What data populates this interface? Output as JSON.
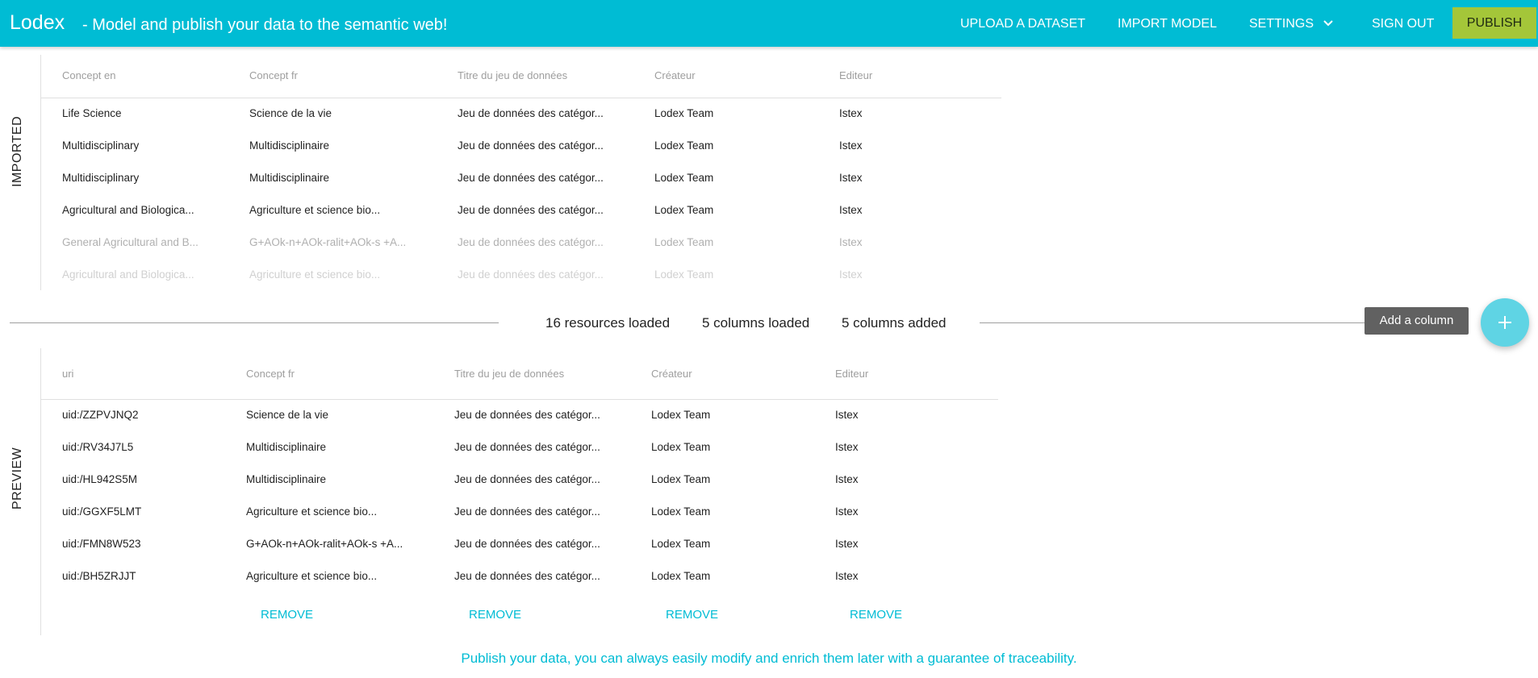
{
  "app": {
    "brand": "Lodex",
    "tagline": "- Model and publish your data to the semantic web!"
  },
  "nav": {
    "upload": "UPLOAD A DATASET",
    "import_model": "IMPORT MODEL",
    "settings": "SETTINGS",
    "sign_out": "SIGN OUT",
    "publish": "PUBLISH",
    "settings_icon": "chevron-down-icon"
  },
  "imported": {
    "label": "IMPORTED",
    "headers": [
      "Concept en",
      "Concept fr",
      "Titre du jeu de données",
      "Créateur",
      "Editeur"
    ],
    "rows": [
      [
        "Life Science",
        "Science de la vie",
        "Jeu de données des catégor...",
        "Lodex Team",
        "Istex"
      ],
      [
        "Multidisciplinary",
        "Multidisciplinaire",
        "Jeu de données des catégor...",
        "Lodex Team",
        "Istex"
      ],
      [
        "Multidisciplinary",
        "Multidisciplinaire",
        "Jeu de données des catégor...",
        "Lodex Team",
        "Istex"
      ],
      [
        "Agricultural and Biologica...",
        "Agriculture et science bio...",
        "Jeu de données des catégor...",
        "Lodex Team",
        "Istex"
      ],
      [
        "General Agricultural and B...",
        "G+AOk-n+AOk-ralit+AOk-s +A...",
        "Jeu de données des catégor...",
        "Lodex Team",
        "Istex"
      ],
      [
        "Agricultural and Biologica...",
        "Agriculture et science bio...",
        "Jeu de données des catégor...",
        "Lodex Team",
        "Istex"
      ]
    ]
  },
  "status": {
    "resources": "16 resources loaded",
    "columns_loaded": "5 columns loaded",
    "columns_added": "5 columns added",
    "add_column_tooltip": "Add a column",
    "fab_icon": "plus-icon"
  },
  "preview": {
    "label": "PREVIEW",
    "headers": [
      "uri",
      "Concept fr",
      "Titre du jeu de données",
      "Créateur",
      "Editeur"
    ],
    "rows": [
      [
        "uid:/ZZPVJNQ2",
        "Science de la vie",
        "Jeu de données des catégor...",
        "Lodex Team",
        "Istex"
      ],
      [
        "uid:/RV34J7L5",
        "Multidisciplinaire",
        "Jeu de données des catégor...",
        "Lodex Team",
        "Istex"
      ],
      [
        "uid:/HL942S5M",
        "Multidisciplinaire",
        "Jeu de données des catégor...",
        "Lodex Team",
        "Istex"
      ],
      [
        "uid:/GGXF5LMT",
        "Agriculture et science bio...",
        "Jeu de données des catégor...",
        "Lodex Team",
        "Istex"
      ],
      [
        "uid:/FMN8W523",
        "G+AOk-n+AOk-ralit+AOk-s +A...",
        "Jeu de données des catégor...",
        "Lodex Team",
        "Istex"
      ],
      [
        "uid:/BH5ZRJJT",
        "Agriculture et science bio...",
        "Jeu de données des catégor...",
        "Lodex Team",
        "Istex"
      ]
    ],
    "remove_label": "REMOVE"
  },
  "footer": {
    "message": "Publish your data, you can always easily modify and enrich them later with a guarantee of traceability."
  }
}
